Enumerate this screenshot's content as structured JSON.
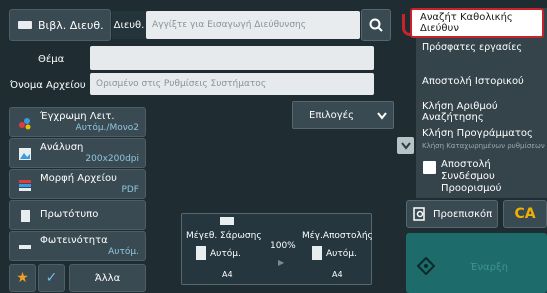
{
  "top": {
    "address_book_label": "Βιβλ. Διευθ.",
    "to_label": "Διευθ.",
    "address_placeholder": "Αγγίξτε για Εισαγωγή Διεύθυνσης"
  },
  "form": {
    "subject_label": "Θέμα",
    "subject_value": "",
    "filename_label": "Όνομα Αρχείου",
    "filename_value": "Ορισμένο στις Ρυθμίσεις Συστήματος"
  },
  "left_buttons": [
    {
      "title": "Έγχρωμη Λειτ.",
      "value": "Αυτόμ./Μονο2"
    },
    {
      "title": "Ανάλυση",
      "value": "200x200dpi"
    },
    {
      "title": "Μορφή Αρχείου",
      "value": "PDF"
    },
    {
      "title": "Πρωτότυπο",
      "value": ""
    },
    {
      "title": "Φωτεινότητα",
      "value": "Αυτόμ."
    }
  ],
  "options_label": "Επιλογές",
  "preview": {
    "scan_size_label": "Μέγεθ. Σάρωσης",
    "scan_size_value": "Αυτόμ.",
    "scan_paper": "A4",
    "ratio": "100%",
    "send_size_label": "Μέγ.Αποστολής",
    "send_size_value": "Αυτόμ.",
    "send_paper": "A4"
  },
  "menu": {
    "items": [
      "Αναζήτ Καθολικής Διεύθυν",
      "Πρόσφατες εργασίες",
      "Αποστολή Ιστορικού",
      "Κλήση Αριθμού Αναζήτησης",
      "Κλήση Προγράμματος",
      "Κλήση Καταχωρημένων ρυθμίσεων",
      "Αποστολή Συνδέσμου Προορισμού"
    ]
  },
  "bottom": {
    "preview_label": "Προεπισκόπ",
    "ca_label": "CA",
    "start_label": "Έναρξη",
    "other_label": "Άλλα"
  },
  "colors": {
    "accent": "#6ec0ea",
    "highlight_border": "#c8222a",
    "start": "#1d6b6a"
  }
}
